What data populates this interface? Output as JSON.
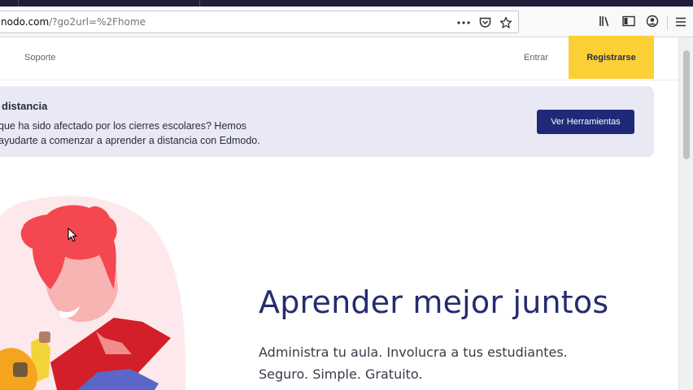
{
  "browser": {
    "url_host": "nodo.com",
    "url_path": "/?go2url=%2Fhome",
    "icons": [
      "more-icon",
      "pocket-icon",
      "bookmark-star-icon",
      "library-icon",
      "sidebar-icon",
      "account-icon",
      "menu-icon"
    ]
  },
  "nav": {
    "support": "Soporte",
    "login": "Entrar",
    "register": "Registrarse"
  },
  "banner": {
    "title": "distancia",
    "line1": "que ha sido afectado por los cierres escolares? Hemos",
    "line2": "ayudarte a comenzar a aprender a distancia con Edmodo.",
    "button": "Ver Herramientas"
  },
  "hero": {
    "title": "Aprender mejor juntos",
    "line1": "Administra tu aula. Involucra a tus estudiantes.",
    "line2": "Seguro. Simple. Gratuito."
  },
  "colors": {
    "brand_navy": "#262b70",
    "button_navy": "#202878",
    "register_yellow": "#fbd034",
    "banner_bg": "#e9e9f6"
  }
}
